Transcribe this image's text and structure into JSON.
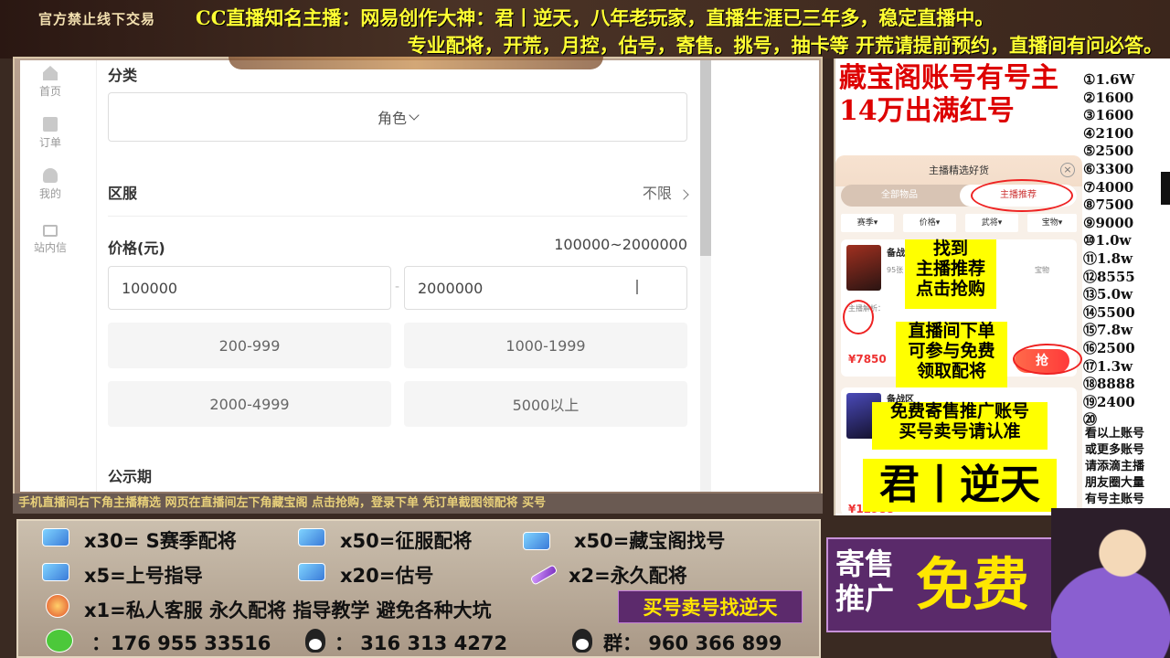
{
  "banner": {
    "warning": "官方禁止线下交易",
    "line1": "CC直播知名主播：网易创作大神：君丨逆天，八年老玩家，直播生涯已三年多，稳定直播中。",
    "line2": "专业配将，开荒，月控，估号，寄售。挑号，抽卡等   开荒请提前预约，直播间有问必答。"
  },
  "sidebar": {
    "items": [
      {
        "label": "首页",
        "icon": "home-icon"
      },
      {
        "label": "订单",
        "icon": "order-icon"
      },
      {
        "label": "我的",
        "icon": "user-icon"
      },
      {
        "label": "站内信",
        "icon": "mail-icon"
      }
    ]
  },
  "filter": {
    "category_title": "分类",
    "category_value": "角色",
    "server_title": "区服",
    "server_value": "不限",
    "price_title": "价格(元)",
    "price_range_display": "100000~2000000",
    "min_value": "100000",
    "max_value": "2000000",
    "dash": "-",
    "chips": [
      "200-999",
      "1000-1999",
      "2000-4999",
      "5000以上"
    ],
    "notice_title": "公示期"
  },
  "ticker": "手机直播间右下角主播精选   网页在直播间左下角藏宝阁    点击抢购，登录下单    凭订单截图领配将    买号",
  "bottom": {
    "line1": [
      {
        "text": "x30= S赛季配将"
      },
      {
        "text": "x50=征服配将"
      },
      {
        "text": "x50=藏宝阁找号"
      }
    ],
    "line2": [
      {
        "text": "x5=上号指导"
      },
      {
        "text": "x20=估号"
      },
      {
        "text": "x2=永久配将"
      }
    ],
    "line3": "x1=私人客服 永久配将  指导教学 避免各种大坑",
    "buy_tag": "买号卖号找逆天",
    "contacts": {
      "wechat": "：176 955 33516",
      "qq": "：  316 313 4272",
      "group": "群：  960 366 899"
    }
  },
  "right": {
    "title_line1": "藏宝阁账号有号主",
    "title_line2": "14万出满红号",
    "prices": [
      "①1.6W",
      "②1600",
      "③1600",
      "④2100",
      "⑤2500",
      "⑥3300",
      "⑦4000",
      "⑧7500",
      "⑨9000",
      "⑩1.0w",
      "⑪1.8w",
      "⑫8555",
      "⑬5.0w",
      "⑭5500",
      "⑮7.8w",
      "⑯2500",
      "⑰1.3w",
      "⑱8888",
      "⑲2400",
      "⑳"
    ],
    "note": [
      "看以上账号",
      "或更多账号",
      "请添滴主播",
      "朋友圈大量",
      "有号主账号"
    ],
    "mobile": {
      "header": "主播精选好货",
      "close": "×",
      "tab_all": "全部物品",
      "tab_pick": "主播推荐",
      "filters": [
        "赛季▾",
        "价格▾",
        "武将▾",
        "宝物▾"
      ],
      "card1_title": "备战",
      "card1_sub": "95张",
      "card1_extra": "宝物",
      "card1_desc": "主播解析：",
      "card1_price": "¥7850",
      "card2_title": "备战区",
      "card2_price": "¥12988",
      "grab": "抢"
    },
    "overlays": {
      "find": "找到\n主播推荐\n点击抢购",
      "order": "直播间下单\n可参与免费\n领取配将",
      "free": "免费寄售推广账号\n买号卖号请认准",
      "name": "君丨逆天"
    },
    "promo": {
      "small": "寄售\n推广",
      "big": "免费"
    }
  },
  "colors": {
    "banner_text": "#ffff33",
    "highlight": "#ffff00",
    "red": "#dd0000",
    "promo_bg": "#5a2a6a"
  }
}
